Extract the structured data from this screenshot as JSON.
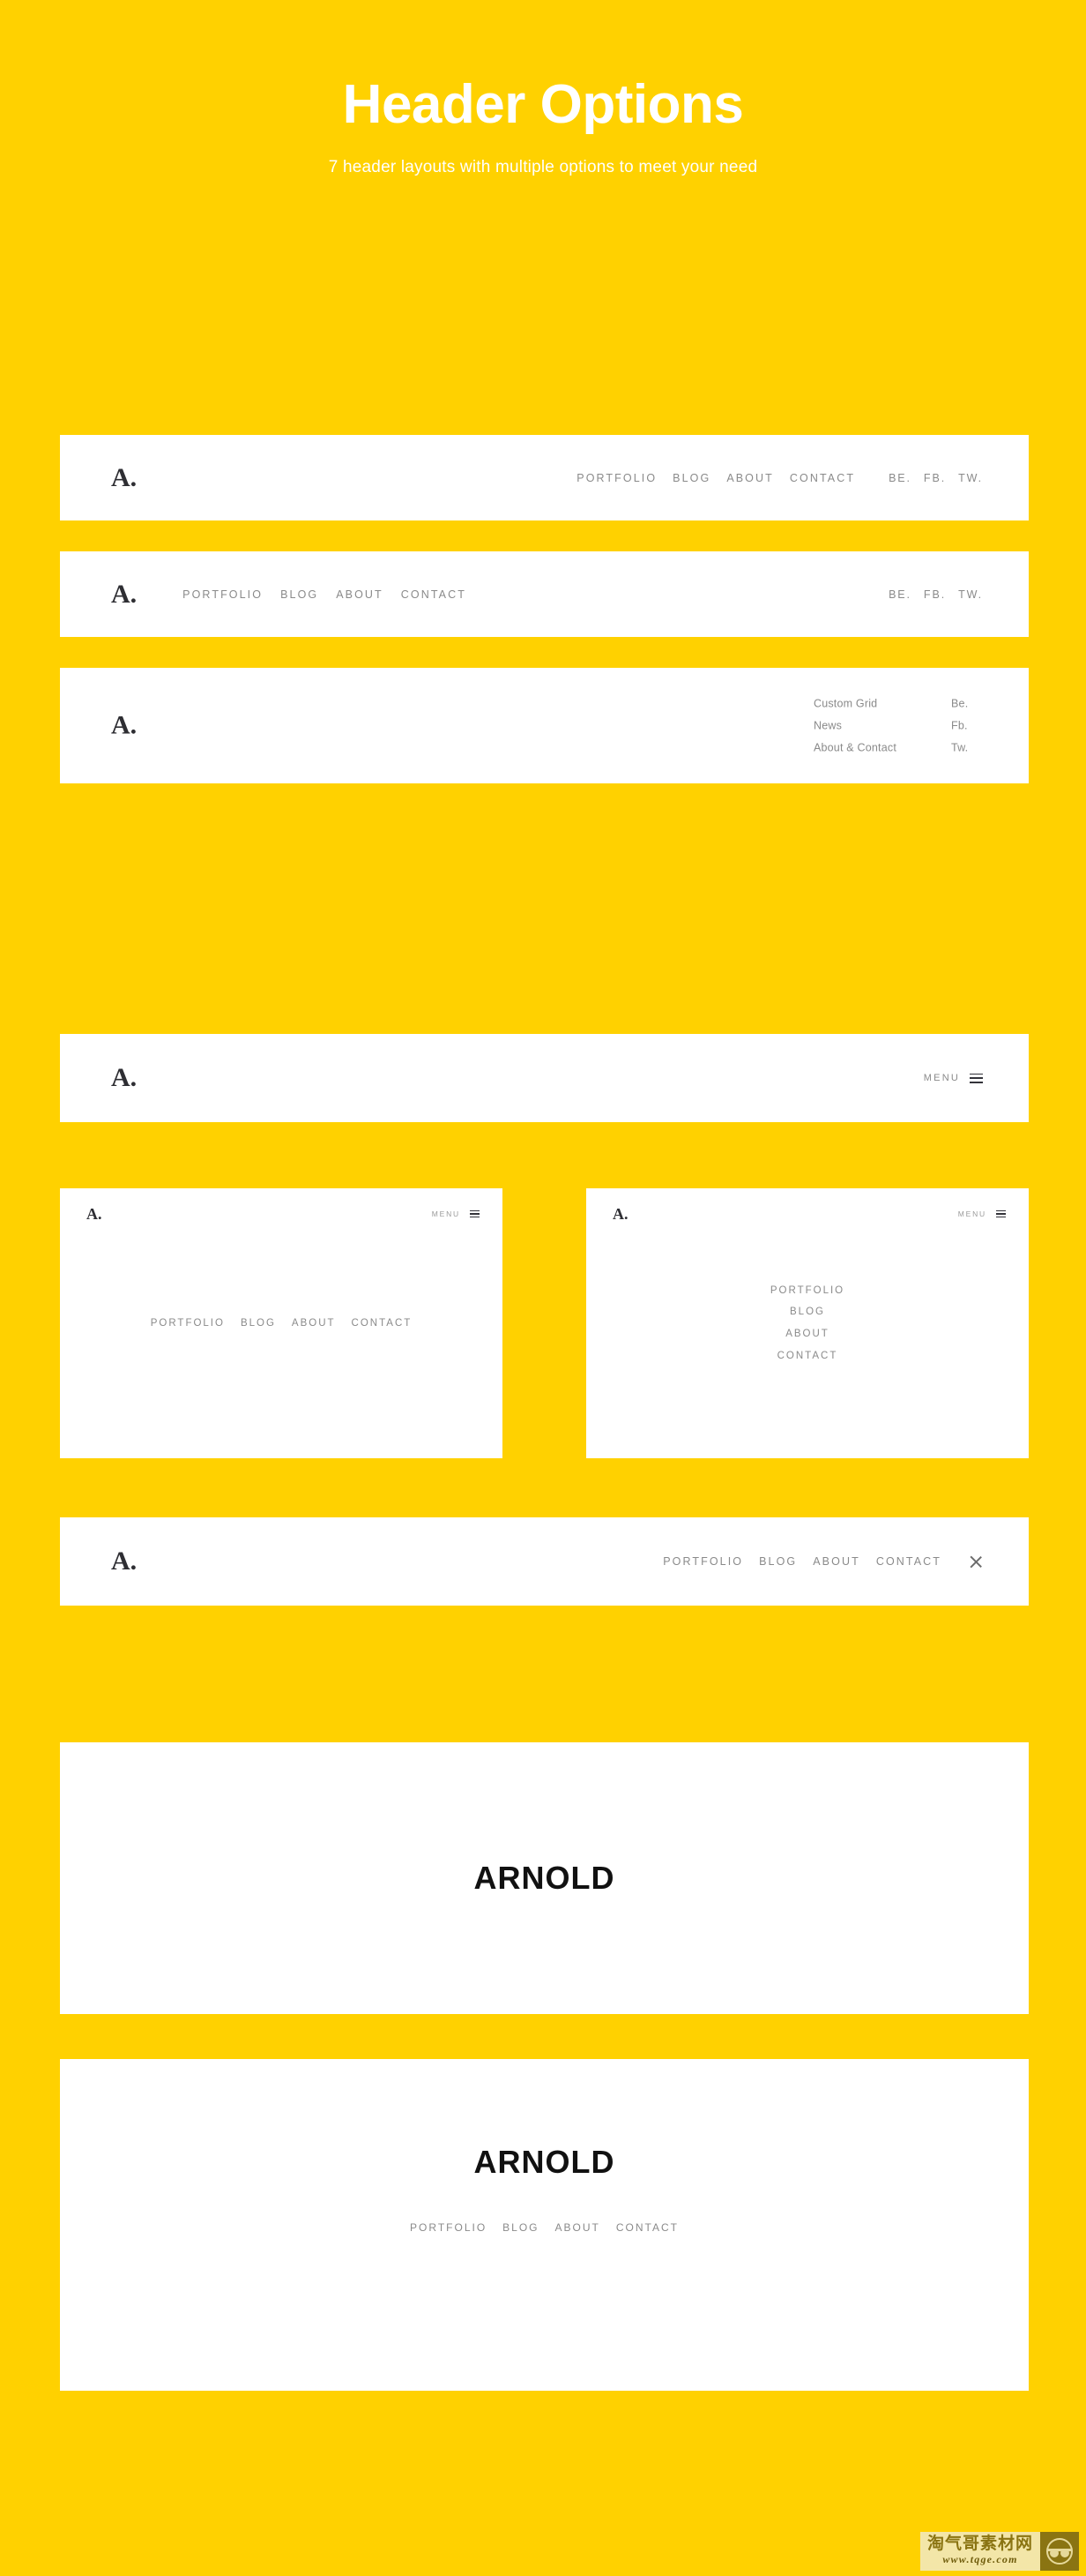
{
  "theme": {
    "background": "#FFD100",
    "card_background": "#FFFFFF",
    "nav_text": "#8A8A8A",
    "logo_text": "#2E2E33",
    "brand_text": "#111111"
  },
  "hero": {
    "title": "Header Options",
    "subtitle": "7 header layouts with multiple options to meet your need"
  },
  "logo": {
    "mark": "A."
  },
  "headers": [
    {
      "id": "header-1",
      "logo": "A.",
      "nav": [
        "PORTFOLIO",
        "BLOG",
        "ABOUT",
        "CONTACT"
      ],
      "social": [
        "BE.",
        "FB.",
        "TW."
      ]
    },
    {
      "id": "header-2",
      "logo": "A.",
      "nav": [
        "PORTFOLIO",
        "BLOG",
        "ABOUT",
        "CONTACT"
      ],
      "social": [
        "BE.",
        "FB.",
        "TW."
      ]
    },
    {
      "id": "header-3",
      "logo": "A.",
      "nav": [
        "Custom Grid",
        "News",
        "About & Contact"
      ],
      "social": [
        "Be.",
        "Fb.",
        "Tw."
      ]
    },
    {
      "id": "header-4",
      "logo": "A.",
      "menu_label": "MENU",
      "menu_icon": "hamburger-icon"
    },
    {
      "id": "header-5-left",
      "logo": "A.",
      "menu_label": "MENU",
      "menu_icon": "hamburger-icon",
      "nav": [
        "PORTFOLIO",
        "BLOG",
        "ABOUT",
        "CONTACT"
      ]
    },
    {
      "id": "header-5-right",
      "logo": "A.",
      "menu_label": "MENU",
      "menu_icon": "hamburger-icon",
      "nav": [
        "PORTFOLIO",
        "BLOG",
        "ABOUT",
        "CONTACT"
      ]
    },
    {
      "id": "header-6",
      "logo": "A.",
      "nav": [
        "PORTFOLIO",
        "BLOG",
        "ABOUT",
        "CONTACT"
      ],
      "close_icon": "close-icon"
    },
    {
      "id": "header-7",
      "brand": "ARNOLD"
    },
    {
      "id": "header-8",
      "brand": "ARNOLD",
      "nav": [
        "PORTFOLIO",
        "BLOG",
        "ABOUT",
        "CONTACT"
      ]
    }
  ],
  "watermark": {
    "name": "淘气哥素材网",
    "url": "www.tqge.com"
  }
}
